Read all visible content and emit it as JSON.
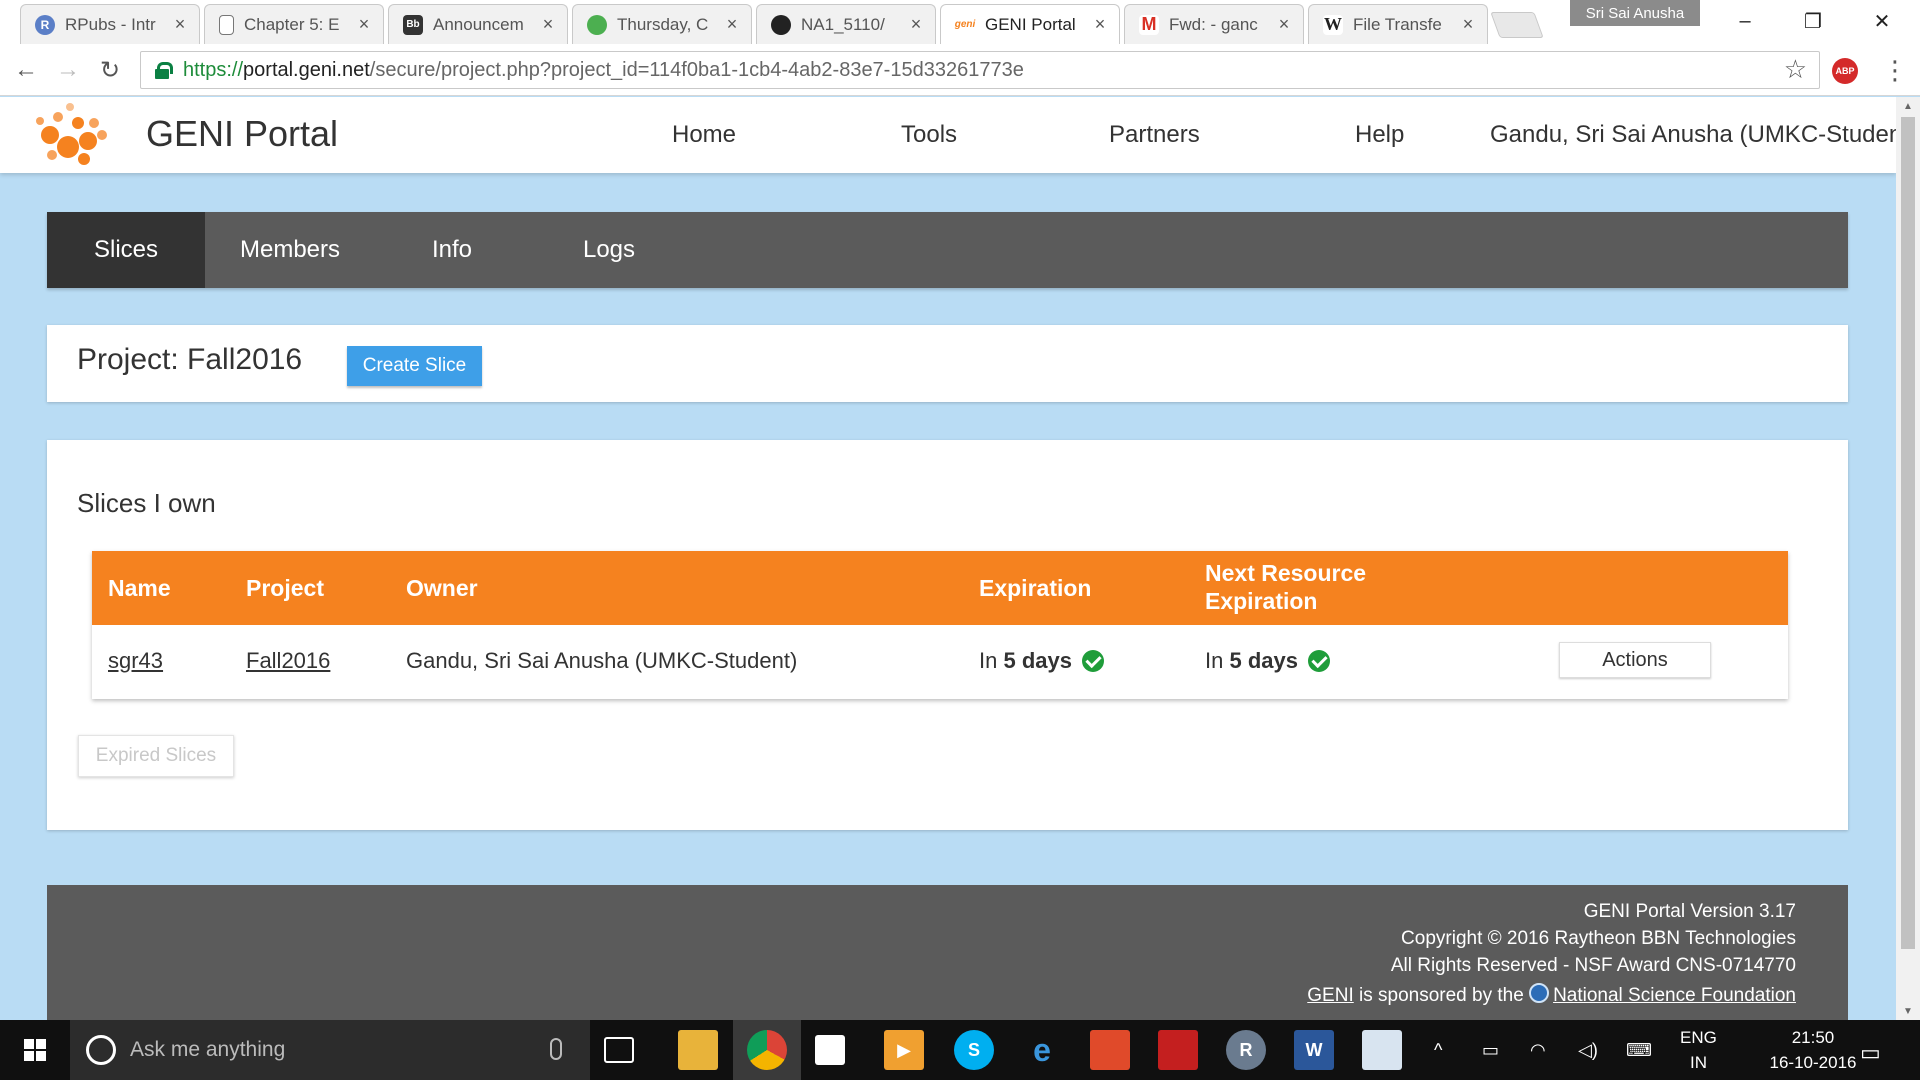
{
  "browser": {
    "tabs": [
      {
        "title": "RPubs - Intr",
        "favicon_color": "#5b7fc7",
        "favicon_glyph": "R",
        "active": false
      },
      {
        "title": "Chapter 5: E",
        "favicon_color": "#ffffff",
        "favicon_glyph": "",
        "active": false
      },
      {
        "title": "Announcem",
        "favicon_color": "#333333",
        "favicon_glyph": "Bb",
        "active": false
      },
      {
        "title": "Thursday, C",
        "favicon_color": "#4caf50",
        "favicon_glyph": "",
        "active": false
      },
      {
        "title": "NA1_5110/",
        "favicon_color": "#222222",
        "favicon_glyph": "",
        "active": false
      },
      {
        "title": "GENI Portal",
        "favicon_color": "#f5821f",
        "favicon_glyph": "geni",
        "active": true
      },
      {
        "title": "Fwd: - ganc",
        "favicon_color": "#d93025",
        "favicon_glyph": "M",
        "active": false
      },
      {
        "title": "File Transfe",
        "favicon_color": "#ffffff",
        "favicon_glyph": "W",
        "active": false
      }
    ],
    "profile_name": "Sri Sai Anusha",
    "url_scheme": "https://",
    "url_host": "portal.geni.net",
    "url_path": "/secure/project.php?project_id=114f0ba1-1cb4-4ab2-83e7-15d33261773e",
    "abp_label": "ABP"
  },
  "site": {
    "title": "GENI Portal",
    "nav": [
      "Home",
      "Tools",
      "Partners",
      "Help"
    ],
    "user": "Gandu, Sri Sai Anusha (UMKC-Student)"
  },
  "subnav": {
    "tabs": [
      {
        "label": "Slices",
        "active": true
      },
      {
        "label": "Members",
        "active": false
      },
      {
        "label": "Info",
        "active": false
      },
      {
        "label": "Logs",
        "active": false
      }
    ]
  },
  "project": {
    "title": "Project: Fall2016",
    "create_label": "Create Slice"
  },
  "slices": {
    "heading": "Slices I own",
    "columns": {
      "name": "Name",
      "project": "Project",
      "owner": "Owner",
      "expiration": "Expiration",
      "next_expiration_line1": "Next Resource",
      "next_expiration_line2": "Expiration"
    },
    "rows": [
      {
        "name": "sgr43",
        "project": "Fall2016",
        "owner": "Gandu, Sri Sai Anusha (UMKC-Student)",
        "expiration_prefix": "In",
        "expiration_value": "5 days",
        "next_prefix": "In",
        "next_value": "5 days",
        "actions_label": "Actions"
      }
    ],
    "expired_label": "Expired Slices"
  },
  "footer": {
    "version": "GENI Portal Version 3.17",
    "copyright": "Copyright © 2016 Raytheon BBN Technologies",
    "rights": "All Rights Reserved - NSF Award CNS-0714770",
    "sponsor_link": "GENI",
    "sponsor_text": " is sponsored by the ",
    "nsf_link": "National Science Foundation"
  },
  "taskbar": {
    "search_placeholder": "Ask me anything",
    "lang_line1": "ENG",
    "lang_line2": "IN",
    "time": "21:50",
    "date": "16-10-2016"
  },
  "colors": {
    "accent_orange": "#f5821f",
    "button_blue": "#3e9fe8",
    "page_bg": "#b9dcf4",
    "nav_dark": "#5b5b5b",
    "check_green": "#1f9d3a"
  }
}
